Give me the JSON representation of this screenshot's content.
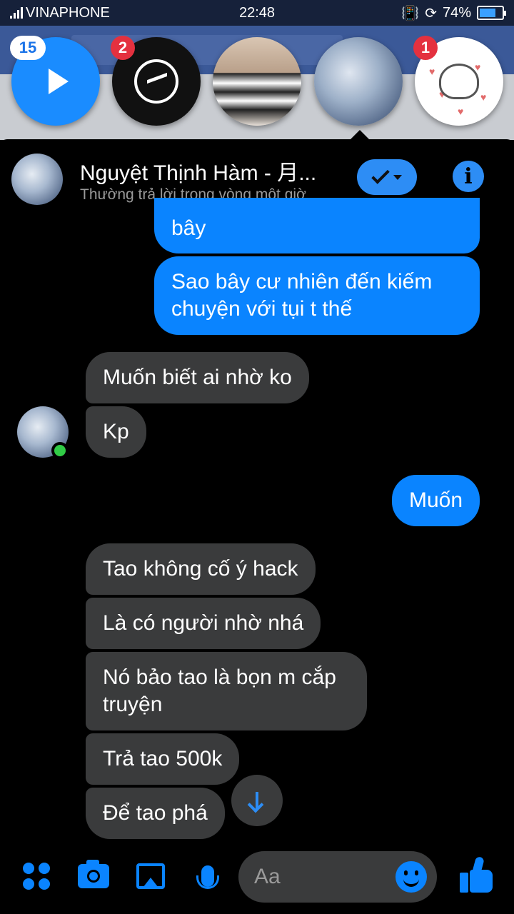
{
  "status_bar": {
    "carrier": "VINAPHONE",
    "time": "22:48",
    "battery": "74%"
  },
  "chat_heads": [
    {
      "badge": "15",
      "icon": "play-icon"
    },
    {
      "badge": "2",
      "icon": "messenger-icon"
    },
    {
      "badge": "",
      "icon": "avatar"
    },
    {
      "badge": "",
      "icon": "avatar"
    },
    {
      "badge": "1",
      "icon": "avatar"
    }
  ],
  "chat_header": {
    "name": "Nguyệt Thịnh Hàm - 月...",
    "subtitle": "Thường trả lời trong vòng một giờ",
    "accent": "#2d8df5"
  },
  "messages": [
    {
      "dir": "out",
      "text": "bây"
    },
    {
      "dir": "out",
      "text": "Sao bây cư nhiên đến kiếm chuyện với tụi t thế"
    },
    {
      "dir": "in",
      "text": "Muốn biết ai nhờ ko"
    },
    {
      "dir": "in",
      "text": "Kp"
    },
    {
      "dir": "out",
      "text": "Muốn"
    },
    {
      "dir": "in",
      "text": "Tao không cố ý hack"
    },
    {
      "dir": "in",
      "text": "Là có người nhờ nhá"
    },
    {
      "dir": "in",
      "text": "Nó bảo tao là bọn m cắp truyện"
    },
    {
      "dir": "in",
      "text": "Trả tao 500k"
    },
    {
      "dir": "in",
      "text": "Để tao phá"
    }
  ],
  "composer": {
    "placeholder": "Aa",
    "accent": "#0a84ff"
  }
}
